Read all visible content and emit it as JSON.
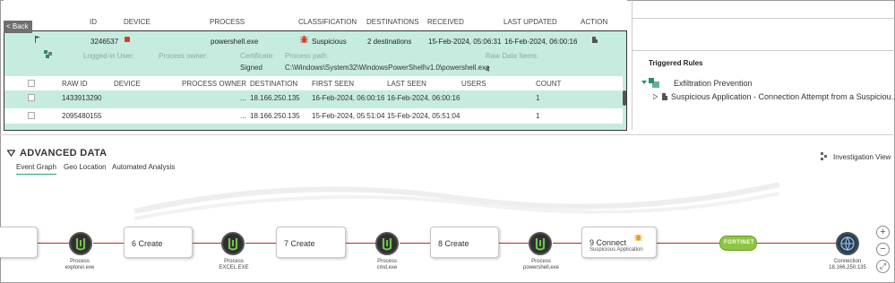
{
  "nav": {
    "back_label": "< Back"
  },
  "table": {
    "columns": [
      "ID",
      "DEVICE",
      "PROCESS",
      "CLASSIFICATION",
      "DESTINATIONS",
      "RECEIVED",
      "LAST UPDATED",
      "ACTION"
    ],
    "row": {
      "id": "3246537",
      "process": "powershell.exe",
      "classification": "Suspicious",
      "destinations": "2 destinations",
      "received": "15-Feb-2024, 05:06:31",
      "last_updated": "16-Feb-2024, 06:00:16"
    },
    "details": {
      "logged_in_label": "Logged-in User:",
      "owner_label": "Process owner:",
      "certificate_label": "Certificate:",
      "certificate_value": "Signed",
      "path_label": "Process path:",
      "path_value": "C:\\Windows\\System32\\WindowsPowerShell\\v1.0\\powershell.exe",
      "raw_items_label": "Raw Data Items:",
      "raw_items_value": "4"
    },
    "sub_columns": [
      "RAW ID",
      "DEVICE",
      "PROCESS OWNER",
      "DESTINATION",
      "FIRST SEEN",
      "LAST SEEN",
      "USERS",
      "COUNT"
    ],
    "sub_rows": [
      {
        "raw_id": "1433913290",
        "owner": "...",
        "destination": "18.166.250.135",
        "first_seen": "16-Feb-2024, 06:00:16",
        "last_seen": "16-Feb-2024, 06:00:16",
        "count": "1"
      },
      {
        "raw_id": "2095480155",
        "owner": "...",
        "destination": "18.166.250.135",
        "first_seen": "15-Feb-2024, 05:51:04",
        "last_seen": "15-Feb-2024, 05:51:04",
        "count": "1"
      }
    ]
  },
  "right_panel": {
    "title": "Triggered Rules",
    "rule_group": "Exfiltration Prevention",
    "rule_item": "Suspicious Application - Connection Attempt from a Suspiciou..."
  },
  "advanced": {
    "title": "ADVANCED DATA",
    "tabs": [
      "Event Graph",
      "Geo Location",
      "Automated Analysis"
    ],
    "investigation_view": "Investigation View"
  },
  "graph": {
    "boxes": [
      "6 Create",
      "7 Create",
      "8 Create",
      "9 Connect"
    ],
    "connect_sub": "Suspicious Application",
    "processes": [
      {
        "type": "Process",
        "name": "explorer.exe"
      },
      {
        "type": "Process",
        "name": "EXCEL.EXE"
      },
      {
        "type": "Process",
        "name": "cmd.exe"
      },
      {
        "type": "Process",
        "name": "powershell.exe"
      }
    ],
    "fortinet_label": "FORTINET",
    "connection_type": "Connection",
    "connection_ip": "18.166.250.135"
  },
  "colors": {
    "selected_row": "#c6ece0",
    "edge": "#b72b2b",
    "accent": "#2aa082",
    "fortinet": "#8dc63f"
  }
}
